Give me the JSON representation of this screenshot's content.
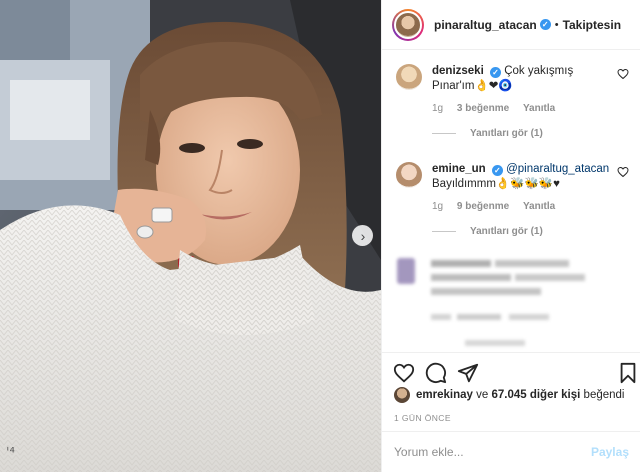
{
  "header": {
    "username": "pinaraltug_atacan",
    "separator": "•",
    "follow_label": "Takiptesin"
  },
  "comments": [
    {
      "username": "denizseki",
      "text": "Çok yakışmış Pınar'ım👌❤🧿",
      "time": "1g",
      "likes": "3 beğenme",
      "reply": "Yanıtla",
      "view_replies": "Yanıtları gör (1)"
    },
    {
      "username": "emine_un",
      "mention": "@pinaraltug_atacan",
      "text": "Bayıldımmm👌🐝🐝🐝♥",
      "time": "1g",
      "likes": "9 beğenme",
      "reply": "Yanıtla",
      "view_replies": "Yanıtları gör (1)"
    }
  ],
  "likes": {
    "user": "emrekinay",
    "connector": "ve",
    "others": "67.045 diğer kişi",
    "suffix": "beğendi"
  },
  "post_time": "1 GÜN ÖNCE",
  "add_comment": {
    "placeholder": "Yorum ekle...",
    "post_label": "Paylaş"
  },
  "photo": {
    "corner_mark": "ˈ⁴"
  },
  "icons": {
    "verified": "verified-badge-icon",
    "like": "heart-icon",
    "comment": "comment-bubble-icon",
    "share": "paper-plane-icon",
    "save": "bookmark-icon",
    "carousel_next": "chevron-right-icon"
  },
  "colors": {
    "verified": "#3897f0",
    "mention": "#00376b",
    "post_disabled": "#b2dffc",
    "meta": "#8e8e8e"
  }
}
